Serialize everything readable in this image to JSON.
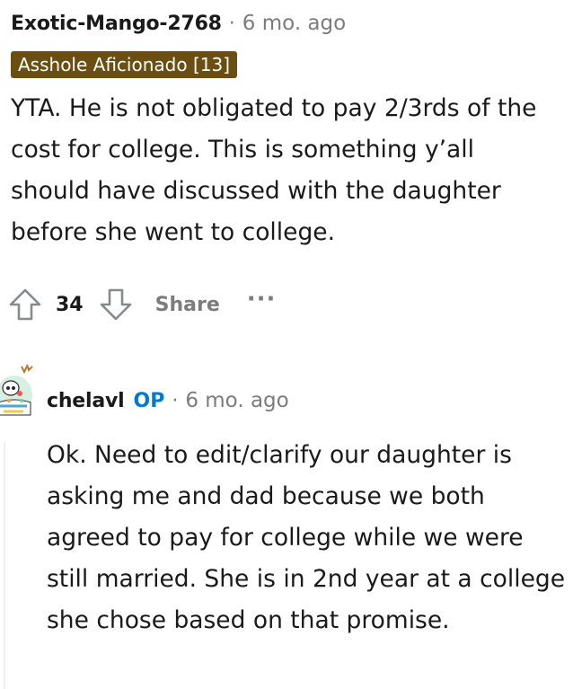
{
  "comment1": {
    "author": "Exotic-Mango-2768",
    "separator": "·",
    "time": "6 mo. ago",
    "flair": "Asshole Aficionado [13]",
    "body": "YTA. He is not obligated to pay 2/3rds of the cost for college. This is something y’all should have discussed with the daughter before she went to college.",
    "score": "34",
    "share_label": "Share",
    "more_label": "···"
  },
  "comment2": {
    "author": "chelavl",
    "op_badge": "OP",
    "separator": "·",
    "time": "6 mo. ago",
    "body": "Ok. Need to edit/clarify our daughter is asking me and dad because we both agreed to pay for college while we were still married. She is in 2nd year at a college she chose based on that promise."
  },
  "icons": {
    "upvote": "upvote-arrow-icon",
    "downvote": "downvote-arrow-icon"
  }
}
